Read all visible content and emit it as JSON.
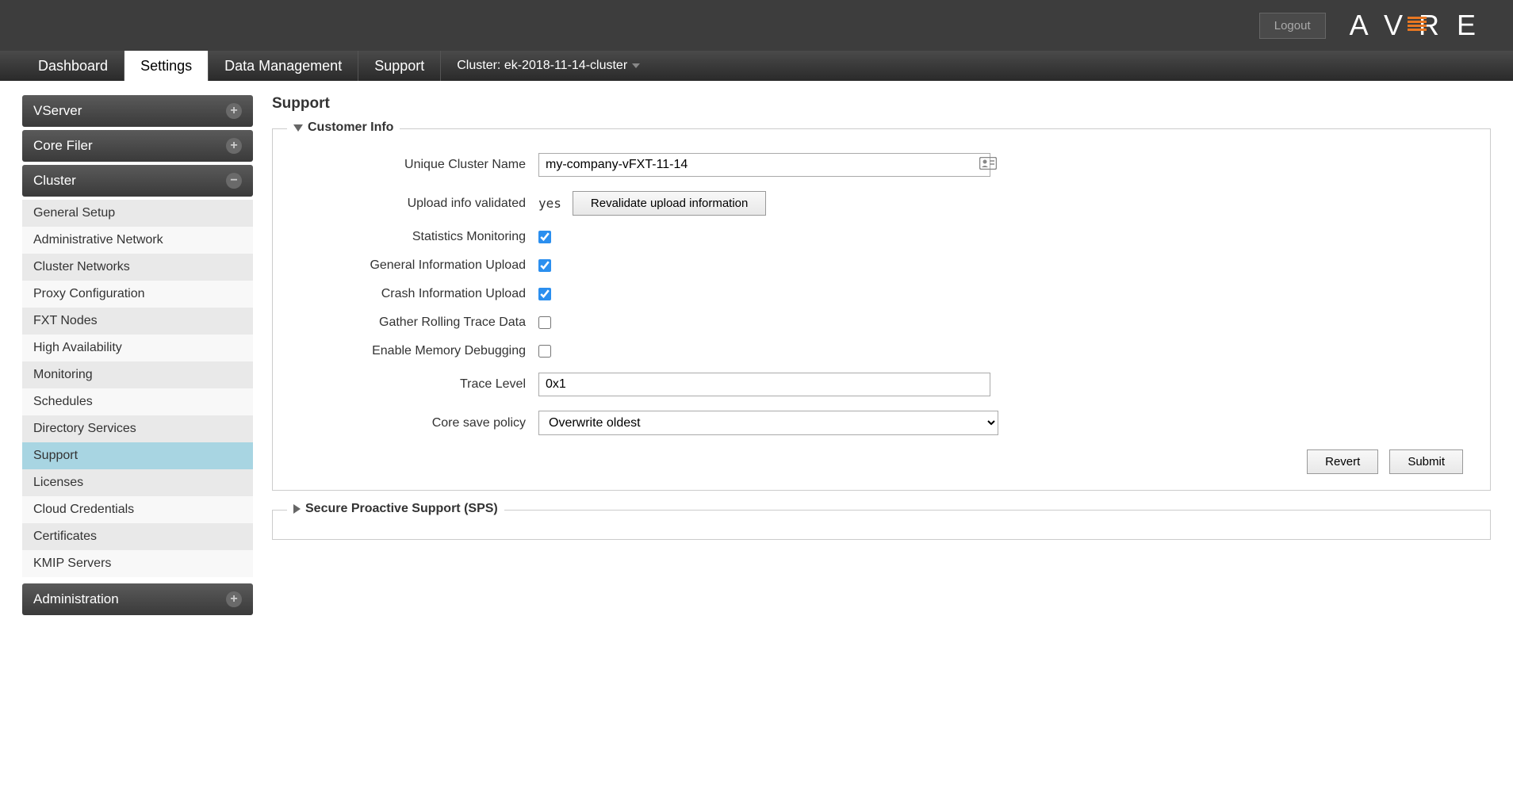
{
  "header": {
    "logout": "Logout",
    "logo_left": "AV",
    "logo_right": "RE"
  },
  "tabs": {
    "dashboard": "Dashboard",
    "settings": "Settings",
    "data_mgmt": "Data Management",
    "support": "Support",
    "cluster_label": "Cluster: ek-2018-11-14-cluster"
  },
  "sidebar": {
    "sections": {
      "vserver": "VServer",
      "core_filer": "Core Filer",
      "cluster": "Cluster",
      "administration": "Administration"
    },
    "cluster_items": [
      "General Setup",
      "Administrative Network",
      "Cluster Networks",
      "Proxy Configuration",
      "FXT Nodes",
      "High Availability",
      "Monitoring",
      "Schedules",
      "Directory Services",
      "Support",
      "Licenses",
      "Cloud Credentials",
      "Certificates",
      "KMIP Servers"
    ]
  },
  "page": {
    "title": "Support",
    "customer_info_legend": "Customer Info",
    "sps_legend": "Secure Proactive Support (SPS)",
    "labels": {
      "cluster_name": "Unique Cluster Name",
      "upload_validated": "Upload info validated",
      "stats_monitoring": "Statistics Monitoring",
      "gen_upload": "General Information Upload",
      "crash_upload": "Crash Information Upload",
      "rolling_trace": "Gather Rolling Trace Data",
      "mem_debug": "Enable Memory Debugging",
      "trace_level": "Trace Level",
      "core_save": "Core save policy"
    },
    "values": {
      "cluster_name": "my-company-vFXT-11-14",
      "upload_validated": "yes",
      "trace_level": "0x1",
      "core_save": "Overwrite oldest"
    },
    "buttons": {
      "revalidate": "Revalidate upload information",
      "revert": "Revert",
      "submit": "Submit"
    }
  }
}
